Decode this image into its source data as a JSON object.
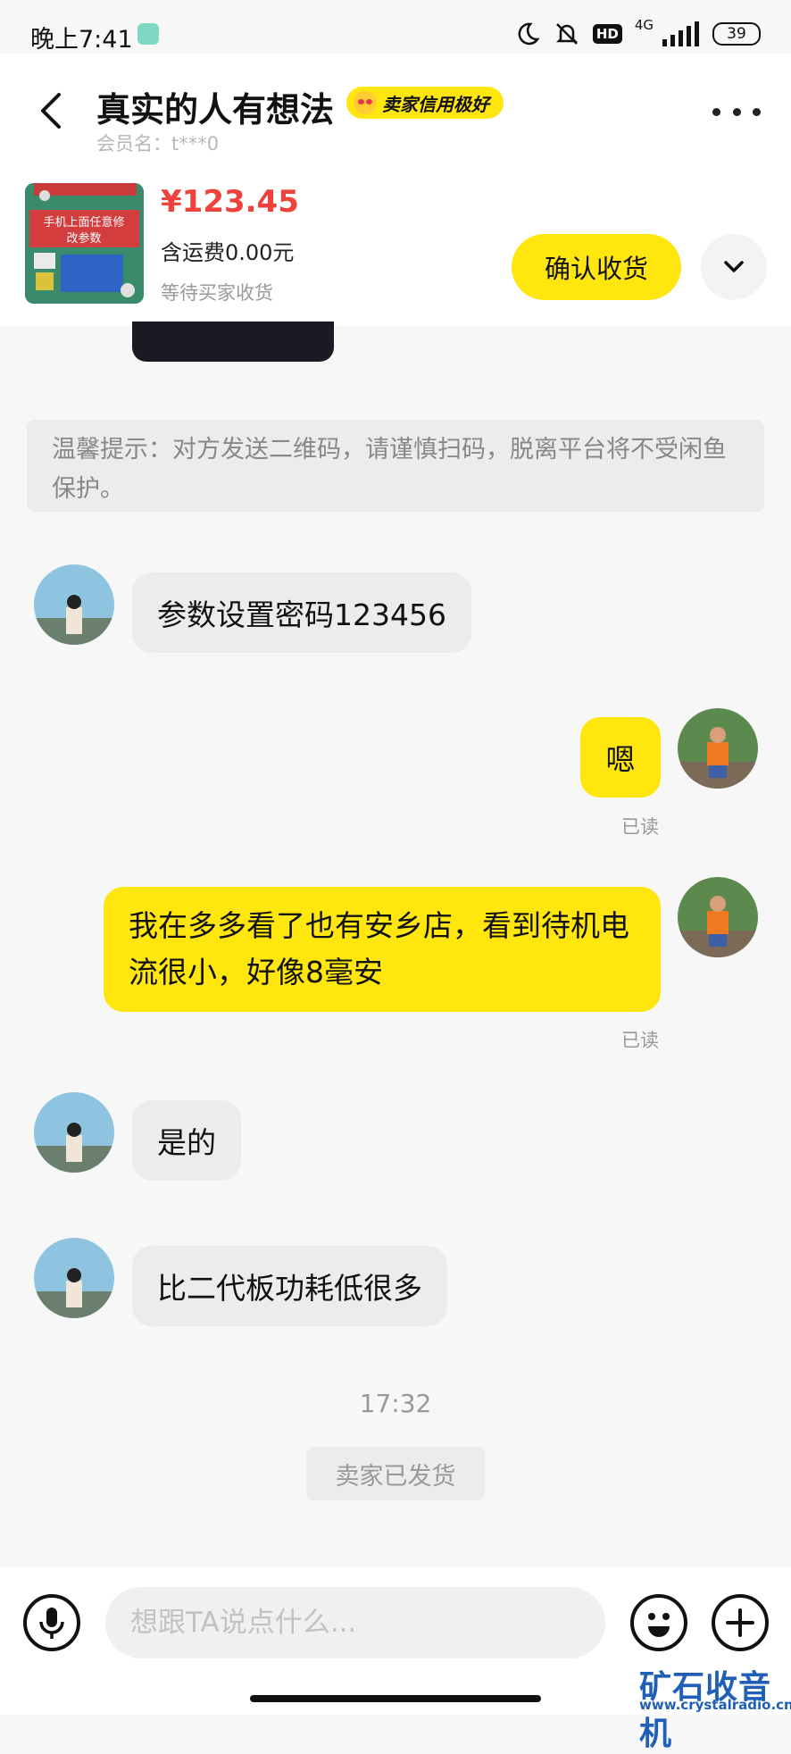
{
  "status_bar": {
    "time": "晚上7:41",
    "network": "4G",
    "hd": "HD",
    "battery": "39"
  },
  "header": {
    "title": "真实的人有想法",
    "credit_badge": "卖家信用极好",
    "member_name": "会员名：t***0",
    "product": {
      "image_caption_line1": "手机上面任意修",
      "image_caption_line2": "改参数",
      "price": "¥123.45",
      "shipping": "含运费0.00元",
      "status": "等待买家收货",
      "confirm_label": "确认收货"
    }
  },
  "notice": "温馨提示：对方发送二维码，请谨慎扫码，脱离平台将不受闲鱼保护。",
  "messages": [
    {
      "side": "left",
      "text": "参数设置密码123456"
    },
    {
      "side": "right",
      "text": "嗯",
      "read": "已读"
    },
    {
      "side": "right",
      "text": "我在多多看了也有安乡店，看到待机电流很小，好像8毫安",
      "read": "已读"
    },
    {
      "side": "left",
      "text": "是的"
    },
    {
      "side": "left",
      "text": "比二代板功耗低很多"
    }
  ],
  "timestamp": "17:32",
  "system_message": "卖家已发货",
  "input": {
    "placeholder": "想跟TA说点什么..."
  },
  "watermark": {
    "main": "矿石收音机",
    "url": "www.crystalradio.cn"
  },
  "colors": {
    "accent_yellow": "#ffe60f",
    "price_red": "#f0423c"
  }
}
